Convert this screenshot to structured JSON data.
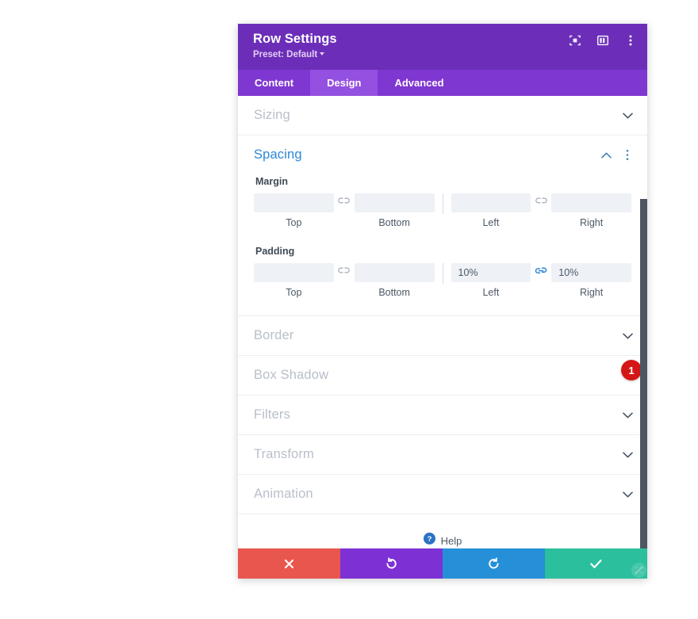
{
  "header": {
    "title": "Row Settings",
    "preset_label": "Preset: Default",
    "icons": {
      "focus": "focus-target-icon",
      "layout": "column-layout-icon",
      "more": "vertical-dots-icon"
    }
  },
  "tabs": [
    {
      "label": "Content",
      "active": false
    },
    {
      "label": "Design",
      "active": true
    },
    {
      "label": "Advanced",
      "active": false
    }
  ],
  "sections": [
    {
      "label": "Sizing",
      "open": false
    },
    {
      "label": "Spacing",
      "open": true
    },
    {
      "label": "Border",
      "open": false
    },
    {
      "label": "Box Shadow",
      "open": false
    },
    {
      "label": "Filters",
      "open": false
    },
    {
      "label": "Transform",
      "open": false
    },
    {
      "label": "Animation",
      "open": false
    }
  ],
  "spacing": {
    "margin": {
      "group_label": "Margin",
      "top": {
        "caption": "Top",
        "value": "",
        "placeholder": ""
      },
      "bottom": {
        "caption": "Bottom",
        "value": "",
        "placeholder": ""
      },
      "left": {
        "caption": "Left",
        "value": "",
        "placeholder": ""
      },
      "right": {
        "caption": "Right",
        "value": "",
        "placeholder": ""
      },
      "link_tb_state": "unlinked",
      "link_lr_state": "unlinked"
    },
    "padding": {
      "group_label": "Padding",
      "top": {
        "caption": "Top",
        "value": "",
        "placeholder": ""
      },
      "bottom": {
        "caption": "Bottom",
        "value": "",
        "placeholder": ""
      },
      "left": {
        "caption": "Left",
        "value": "10%",
        "placeholder": ""
      },
      "right": {
        "caption": "Right",
        "value": "10%",
        "placeholder": ""
      },
      "link_tb_state": "unlinked",
      "link_lr_state": "linked"
    },
    "badge": "1"
  },
  "help": {
    "label": "Help",
    "icon": "question-mark-icon"
  },
  "footer": {
    "close_label": "✖",
    "undo_label": "↺",
    "redo_label": "↻",
    "save_label": "✔"
  },
  "colors": {
    "header_purple": "#6c2eb9",
    "tabbar_purple": "#7f37d1",
    "tab_active_purple": "#9450e0",
    "accent_blue": "#2b87da",
    "badge_red": "#d51616",
    "btn_close_red": "#e8564d",
    "btn_undo_purple": "#7d31d4",
    "btn_redo_blue": "#2590d8",
    "btn_save_green": "#2bbf9e",
    "input_bg": "#eef1f6",
    "section_title_gray": "#b8bfc9"
  }
}
